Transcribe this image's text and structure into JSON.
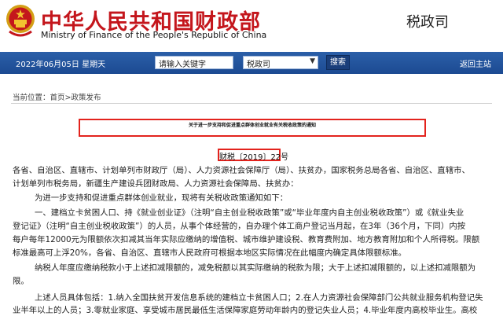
{
  "header": {
    "ministry_cn": "中华人民共和国财政部",
    "ministry_en": "Ministry of Finance of the People's Republic of China",
    "department": "税政司"
  },
  "nav": {
    "date": "2022年06月05日  星期天",
    "search_input_value": "请输入关键字",
    "select_value": "税政司",
    "search_button": "搜索",
    "home_link": "返回主站"
  },
  "breadcrumb": "当前位置：首页>政策发布",
  "article": {
    "title": "关于进一步支持和促进重点群体创业就业有关税收政策的通知",
    "doc_number": "财税〔2019〕22号",
    "lines": [
      "各省、自治区、直辖市、计划单列市财政厅（局）、人力资源社会保障厅（局）、扶贫办，国家税务总局各省、自治区、直辖市、",
      "计划单列市税务局，新疆生产建设兵团财政局、人力资源社会保障局、扶贫办：",
      "为进一步支持和促进重点群体创业就业，现将有关税收政策通知如下：",
      "一、建档立卡贫困人口、持《就业创业证》（注明“自主创业税收政策”或“毕业年度内自主创业税收政策”）或《就业失业",
      "登记证》（注明“自主创业税收政策”）的人员，从事个体经营的，自办理个体工商户登记当月起，在3年（36个月，下同）内按",
      "每户每年12000元为限额依次扣减其当年实际应缴纳的增值税、城市维护建设税、教育费附加、地方教育附加和个人所得税。限额",
      "标准最高可上浮20%，各省、自治区、直辖市人民政府可根据本地区实际情况在此幅度内确定具体限额标准。",
      "纳税人年度应缴纳税款小于上述扣减限额的，减免税额以其实际缴纳的税款为限；大于上述扣减限额的，以上述扣减限额为",
      "限。",
      "上述人员具体包括：1.纳入全国扶贫开发信息系统的建档立卡贫困人口；2.在人力资源社会保障部门公共就业服务机构登记失",
      "业半年以上的人员；3.零就业家庭、享受城市居民最低生活保障家庭劳动年龄内的登记失业人员；4.毕业年度内高校毕业生。高校"
    ]
  },
  "colors": {
    "brand_red": "#c4161c",
    "nav_blue": "#1c4a92",
    "highlight_red": "#e3231d"
  },
  "icons": {
    "emblem": "national-emblem-icon",
    "select_arrow": "chevron-down-icon"
  }
}
